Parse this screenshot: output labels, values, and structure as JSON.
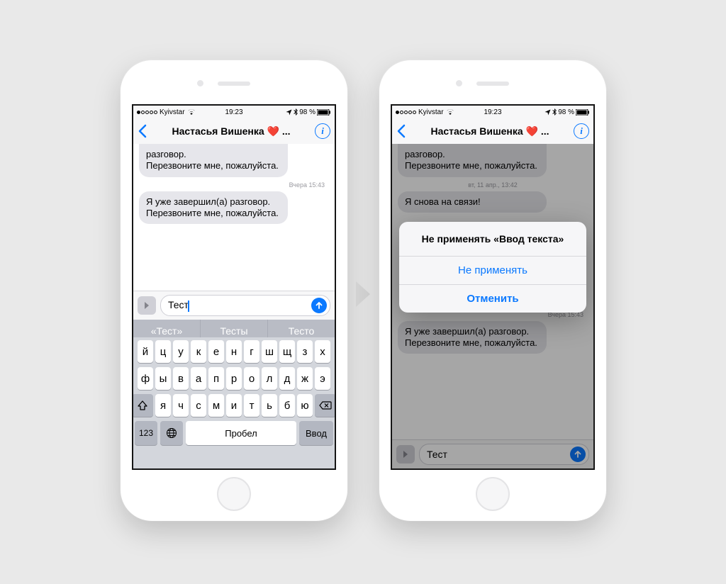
{
  "status": {
    "carrier": "Kyivstar",
    "time": "19:23",
    "battery": "98 %"
  },
  "nav": {
    "title": "Настасья Вишенка ❤️ ..."
  },
  "messages_left": {
    "m1": "разговор.\nПерезвоните мне, пожалуйста.",
    "t1": "Вчера 15:43",
    "m2": "Я уже завершил(а) разговор.\nПерезвоните мне, пожалуйста."
  },
  "messages_right": {
    "m1": "разговор.\nПерезвоните мне, пожалуйста.",
    "t1": "вт, 11 апр., 13:42",
    "m2": "Я снова на связи!",
    "t2": "Вчера 15:43",
    "m3": "Я уже завершил(а) разговор.\nПерезвоните мне, пожалуйста."
  },
  "composer": {
    "text_left": "Тест",
    "text_right": "Тест"
  },
  "predict": {
    "p1": "«Тест»",
    "p2": "Тесты",
    "p3": "Тесто"
  },
  "kbd": {
    "r1": [
      "й",
      "ц",
      "у",
      "к",
      "е",
      "н",
      "г",
      "ш",
      "щ",
      "з",
      "х"
    ],
    "r2": [
      "ф",
      "ы",
      "в",
      "а",
      "п",
      "р",
      "о",
      "л",
      "д",
      "ж",
      "э"
    ],
    "r3": [
      "я",
      "ч",
      "с",
      "м",
      "и",
      "т",
      "ь",
      "б",
      "ю"
    ],
    "num": "123",
    "space": "Пробел",
    "enter": "Ввод"
  },
  "dialog": {
    "title": "Не применять «Ввод текста»",
    "btn1": "Не применять",
    "btn2": "Отменить"
  }
}
